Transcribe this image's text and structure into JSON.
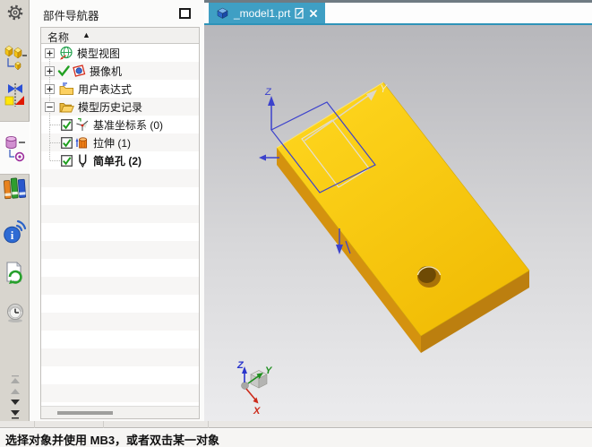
{
  "resource_bar": {
    "items": [
      {
        "icon": "gear-icon"
      },
      {
        "icon": "assembly-navigator-icon"
      },
      {
        "icon": "constraint-navigator-icon"
      },
      {
        "icon": "part-navigator-icon",
        "selected": true
      },
      {
        "icon": "reuse-library-icon"
      },
      {
        "icon": "internet-icon"
      },
      {
        "icon": "history-icon"
      },
      {
        "icon": "process-clock-icon"
      }
    ]
  },
  "navigator": {
    "title": "部件导航器",
    "column_header": "名称",
    "sort_indicator": "▲",
    "tree": [
      {
        "label": "模型视图",
        "icon": "model-views-icon",
        "expand": "plus"
      },
      {
        "label": "摄像机",
        "icon": "camera-icon",
        "expand": "plus",
        "check_mark": true
      },
      {
        "label": "用户表达式",
        "icon": "expressions-folder-icon",
        "expand": "plus"
      },
      {
        "label": "模型历史记录",
        "icon": "open-folder-icon",
        "expand": "minus"
      },
      {
        "label": "基准坐标系 (0)",
        "icon": "datum-csys-icon",
        "checkbox": "checked"
      },
      {
        "label": "拉伸 (1)",
        "icon": "extrude-icon",
        "checkbox": "checked"
      },
      {
        "label": "简单孔 (2)",
        "icon": "hole-icon",
        "checkbox": "checked",
        "bold": true
      }
    ]
  },
  "tabs": {
    "active": {
      "title": "_model1.prt"
    }
  },
  "viewport": {
    "model_axes": {
      "z": "Z",
      "y": "Y"
    },
    "triad": {
      "z": "Z",
      "y": "Y",
      "x": "X"
    }
  },
  "status_bar": {
    "message": "选择对象并使用 MB3，或者双击某一对象"
  },
  "glyphs": {
    "info": "i"
  },
  "colors": {
    "tab_active": "#3f9fc4",
    "accent_line": "#2e93b8",
    "model_top_face": "#f6c40c",
    "model_side_light": "#d4920f",
    "model_side_dark": "#bc7f0f",
    "sketch_blue": "#3c42cc",
    "check_green": "#21a021",
    "resource_bar_bg": "#d8d5ce",
    "viewport_gradient_top": "#b7b7bb",
    "viewport_gradient_bottom": "#ececee"
  }
}
